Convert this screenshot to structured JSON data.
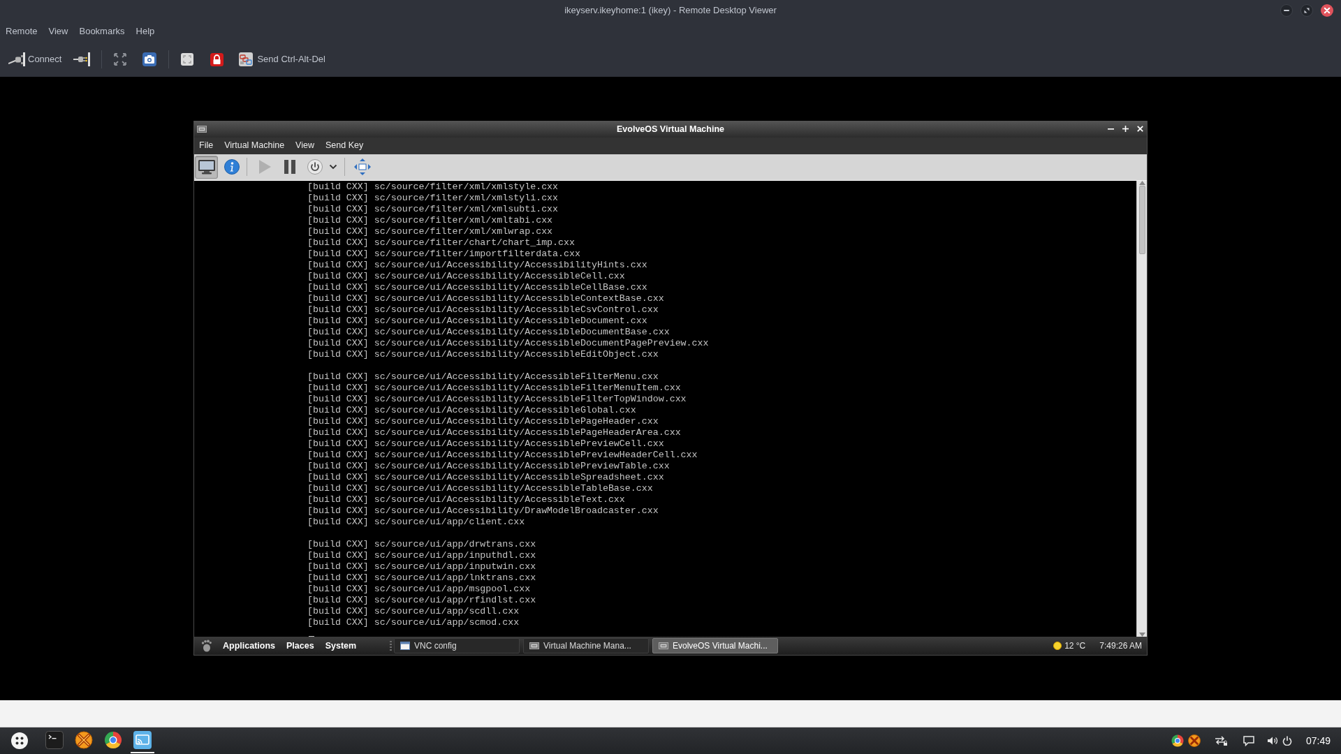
{
  "window": {
    "title": "ikeyserv.ikeyhome:1 (ikey) - Remote Desktop Viewer"
  },
  "menu": [
    "Remote",
    "View",
    "Bookmarks",
    "Help"
  ],
  "toolbar": {
    "connect_label": "Connect",
    "send_keys_label": "Send Ctrl-Alt-Del"
  },
  "vm_window": {
    "title": "EvolveOS Virtual Machine",
    "menu": [
      "File",
      "Virtual Machine",
      "View",
      "Send Key"
    ],
    "toolbar": [
      {
        "pressed": true,
        "disabled": false
      },
      {
        "pressed": false,
        "disabled": false
      },
      {
        "pressed": false,
        "disabled": true
      },
      {
        "pressed": false,
        "disabled": false
      },
      {
        "pressed": false,
        "disabled": false
      },
      {
        "pressed": false,
        "disabled": false
      },
      {
        "pressed": false,
        "disabled": false
      }
    ],
    "console": {
      "blocks": [
        [
          "[build CXX] sc/source/filter/xml/xmlstyle.cxx",
          "[build CXX] sc/source/filter/xml/xmlstyli.cxx",
          "[build CXX] sc/source/filter/xml/xmlsubti.cxx",
          "[build CXX] sc/source/filter/xml/xmltabi.cxx",
          "[build CXX] sc/source/filter/xml/xmlwrap.cxx",
          "[build CXX] sc/source/filter/chart/chart_imp.cxx",
          "[build CXX] sc/source/filter/importfilterdata.cxx",
          "[build CXX] sc/source/ui/Accessibility/AccessibilityHints.cxx",
          "[build CXX] sc/source/ui/Accessibility/AccessibleCell.cxx",
          "[build CXX] sc/source/ui/Accessibility/AccessibleCellBase.cxx",
          "[build CXX] sc/source/ui/Accessibility/AccessibleContextBase.cxx",
          "[build CXX] sc/source/ui/Accessibility/AccessibleCsvControl.cxx",
          "[build CXX] sc/source/ui/Accessibility/AccessibleDocument.cxx",
          "[build CXX] sc/source/ui/Accessibility/AccessibleDocumentBase.cxx",
          "[build CXX] sc/source/ui/Accessibility/AccessibleDocumentPagePreview.cxx",
          "[build CXX] sc/source/ui/Accessibility/AccessibleEditObject.cxx"
        ],
        [
          "[build CXX] sc/source/ui/Accessibility/AccessibleFilterMenu.cxx",
          "[build CXX] sc/source/ui/Accessibility/AccessibleFilterMenuItem.cxx",
          "[build CXX] sc/source/ui/Accessibility/AccessibleFilterTopWindow.cxx",
          "[build CXX] sc/source/ui/Accessibility/AccessibleGlobal.cxx",
          "[build CXX] sc/source/ui/Accessibility/AccessiblePageHeader.cxx",
          "[build CXX] sc/source/ui/Accessibility/AccessiblePageHeaderArea.cxx",
          "[build CXX] sc/source/ui/Accessibility/AccessiblePreviewCell.cxx",
          "[build CXX] sc/source/ui/Accessibility/AccessiblePreviewHeaderCell.cxx",
          "[build CXX] sc/source/ui/Accessibility/AccessiblePreviewTable.cxx",
          "[build CXX] sc/source/ui/Accessibility/AccessibleSpreadsheet.cxx",
          "[build CXX] sc/source/ui/Accessibility/AccessibleTableBase.cxx",
          "[build CXX] sc/source/ui/Accessibility/AccessibleText.cxx",
          "[build CXX] sc/source/ui/Accessibility/DrawModelBroadcaster.cxx",
          "[build CXX] sc/source/ui/app/client.cxx"
        ],
        [
          "[build CXX] sc/source/ui/app/drwtrans.cxx",
          "[build CXX] sc/source/ui/app/inputhdl.cxx",
          "[build CXX] sc/source/ui/app/inputwin.cxx",
          "[build CXX] sc/source/ui/app/lnktrans.cxx",
          "[build CXX] sc/source/ui/app/msgpool.cxx",
          "[build CXX] sc/source/ui/app/rfindlst.cxx",
          "[build CXX] sc/source/ui/app/scdll.cxx",
          "[build CXX] sc/source/ui/app/scmod.cxx"
        ]
      ]
    },
    "panel": {
      "menus": [
        "Applications",
        "Places",
        "System"
      ],
      "tasks": [
        {
          "label": "VNC config",
          "selected": false
        },
        {
          "label": "Virtual Machine Mana...",
          "selected": false
        },
        {
          "label": "EvolveOS Virtual Machi...",
          "selected": true
        }
      ],
      "weather": "12 °C",
      "clock": "7:49:26 AM"
    }
  },
  "taskbar": {
    "launchers": [
      {
        "running": false
      },
      {
        "running": false
      },
      {
        "running": false
      },
      {
        "running": true
      }
    ],
    "clock": "07:49"
  }
}
